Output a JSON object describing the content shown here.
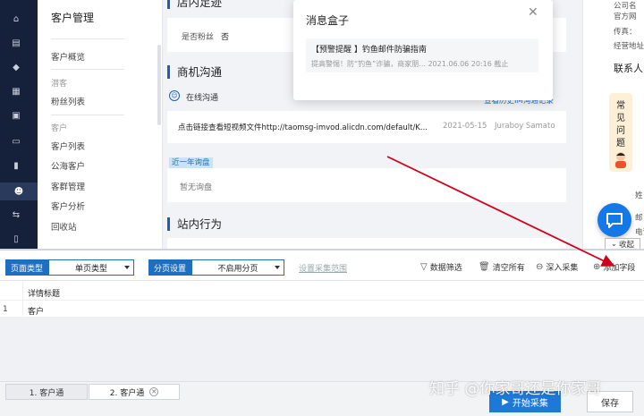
{
  "sidebar_icons": [
    "home-icon",
    "store-icon",
    "shield-icon",
    "apps-icon",
    "calendar-icon",
    "message-icon",
    "chart-icon",
    "users-icon",
    "exchange-icon",
    "clipboard-icon"
  ],
  "subnav": {
    "title": "客户管理",
    "items": [
      {
        "type": "item",
        "label": "客户概览"
      },
      {
        "type": "group",
        "label": "潜客"
      },
      {
        "type": "item",
        "label": "粉丝列表"
      },
      {
        "type": "group",
        "label": "客户"
      },
      {
        "type": "item",
        "label": "客户列表"
      },
      {
        "type": "item",
        "label": "公海客户"
      },
      {
        "type": "item",
        "label": "客群管理"
      },
      {
        "type": "item",
        "label": "客户分析"
      },
      {
        "type": "item",
        "label": "回收站"
      }
    ]
  },
  "main": {
    "section_store_trace": "店内足迹",
    "fan_label": "是否粉丝",
    "fan_value": "否",
    "section_business": "商机沟通",
    "online_chat_label": "在线沟通",
    "view_history_link": "查看历史IM沟通记录",
    "message_text": "点击链接查看短视频文件http://taomsg-imvod.alicdn.com/default/K...",
    "message_date": "2021-05-15",
    "message_sender": "Juraboy Samato",
    "recent_inquiry_label": "近一年询盘",
    "no_inquiry_text": "暂无询盘",
    "section_site_behavior": "站内行为"
  },
  "right_panel": {
    "lines": [
      "公司名",
      "官方网",
      "传真：",
      "经营地址"
    ],
    "contact_heading": "联系人",
    "faq_chars": [
      "常",
      "见",
      "问",
      "题"
    ],
    "side_texts": [
      "姓",
      "邮",
      "电话"
    ],
    "collapse_label": "收起"
  },
  "popup": {
    "title": "消息盒子",
    "item_title": "【预警提醒 】钓鱼邮件防骗指南",
    "item_summary": "提高警惕！防“钓鱼”诈骗，商家朋... 2021.06.06 20:16 截止"
  },
  "toolbar": {
    "page_type_label": "页面类型",
    "page_type_value": "单页类型",
    "pagination_label": "分页设置",
    "pagination_value": "不启用分页",
    "collect_range_link": "设置采集范围",
    "filter_label": "数据筛选",
    "clear_label": "清空所有",
    "deep_collect_label": "深入采集",
    "add_field_label": "添加字段"
  },
  "grid": {
    "header": "详情标题",
    "rows": [
      {
        "index": "1",
        "value": "客户"
      }
    ]
  },
  "tabs": [
    {
      "label": "1. 客户通"
    },
    {
      "label": "2. 客户通"
    }
  ],
  "buttons": {
    "start": "开始采集",
    "save": "保存"
  },
  "watermark": "知乎 @你家哥还是你家哥",
  "colors": {
    "nav_dark": "#15213a",
    "accent_blue": "#1f6fc1",
    "arrow_red": "#d0021b"
  }
}
